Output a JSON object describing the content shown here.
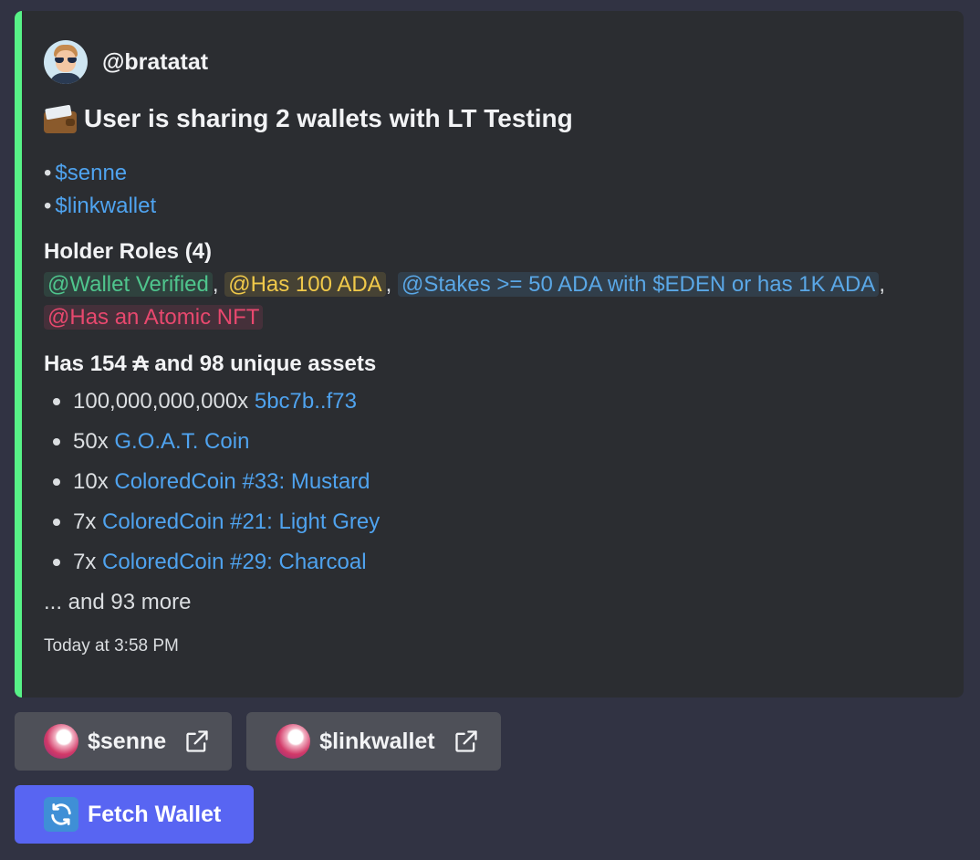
{
  "author": {
    "name": "@bratatat",
    "avatar_icon": "user-avatar"
  },
  "embed": {
    "accent_color": "#57f287",
    "title_icon": "wallet-icon",
    "title": "User is sharing 2 wallets with LT Testing",
    "wallets": [
      {
        "bullet": "•",
        "label": "$senne"
      },
      {
        "bullet": "•",
        "label": "$linkwallet"
      }
    ],
    "roles_heading": "Holder Roles (4)",
    "roles": [
      {
        "label": "@Wallet Verified",
        "color": "#4fc58d"
      },
      {
        "label": "@Has 100 ADA",
        "color": "#f0c94a"
      },
      {
        "label": "@Stakes >= 50 ADA with $EDEN or has 1K ADA",
        "color": "#5aa7e6"
      },
      {
        "label": "@Has an Atomic NFT",
        "color": "#e8486e"
      }
    ],
    "role_separator": ",",
    "assets_heading": "Has 154 ₳ and 98 unique assets",
    "assets": [
      {
        "qty": "100,000,000,000x",
        "name": "5bc7b..f73"
      },
      {
        "qty": "50x",
        "name": "G.O.A.T. Coin"
      },
      {
        "qty": "10x",
        "name": "ColoredCoin #33: Mustard"
      },
      {
        "qty": "7x",
        "name": "ColoredCoin #21: Light Grey"
      },
      {
        "qty": "7x",
        "name": "ColoredCoin #29: Charcoal"
      }
    ],
    "more_text": "... and 93 more",
    "timestamp": "Today at 3:58 PM"
  },
  "buttons": {
    "wallet_links": [
      {
        "label": "$senne",
        "icon": "orb-icon",
        "trailing_icon": "external-link-icon"
      },
      {
        "label": "$linkwallet",
        "icon": "orb-icon",
        "trailing_icon": "external-link-icon"
      }
    ],
    "fetch": {
      "label": "Fetch Wallet",
      "icon": "refresh-icon"
    }
  }
}
